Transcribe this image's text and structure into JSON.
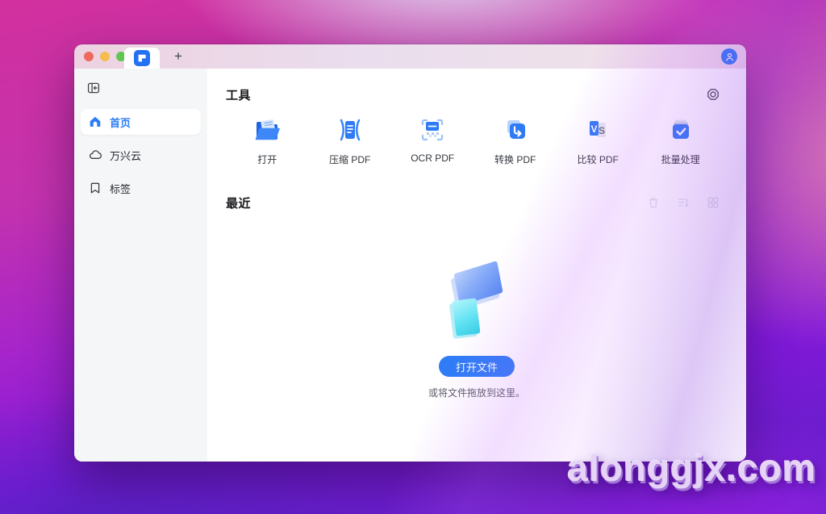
{
  "app": {
    "tab_new_label": "+"
  },
  "sidebar": {
    "items": [
      {
        "label": "首页",
        "icon": "home",
        "active": true
      },
      {
        "label": "万兴云",
        "icon": "cloud",
        "active": false
      },
      {
        "label": "标签",
        "icon": "bookmark",
        "active": false
      }
    ]
  },
  "tools": {
    "title": "工具",
    "items": [
      {
        "label": "打开",
        "icon": "open-folder"
      },
      {
        "label": "压缩 PDF",
        "icon": "compress-pdf"
      },
      {
        "label": "OCR PDF",
        "icon": "ocr-pdf"
      },
      {
        "label": "转换 PDF",
        "icon": "convert-pdf"
      },
      {
        "label": "比较 PDF",
        "icon": "compare-pdf"
      },
      {
        "label": "批量处理",
        "icon": "batch-process"
      }
    ]
  },
  "recent": {
    "title": "最近",
    "actions": [
      {
        "icon": "delete"
      },
      {
        "icon": "sort-descending"
      },
      {
        "icon": "grid-view"
      }
    ]
  },
  "empty_state": {
    "open_button": "打开文件",
    "hint": "或将文件拖放到这里。"
  },
  "watermark": "alonggjx.com",
  "colors": {
    "accent": "#2F7CF6",
    "sidebar_active_text": "#2B7DF5",
    "traffic_red": "#EE6A5F",
    "traffic_yellow": "#F5BD4F",
    "traffic_green": "#61C554",
    "titlebar_tint": "#EDD8E7",
    "compare_v_badge": "#2F7CF6"
  }
}
